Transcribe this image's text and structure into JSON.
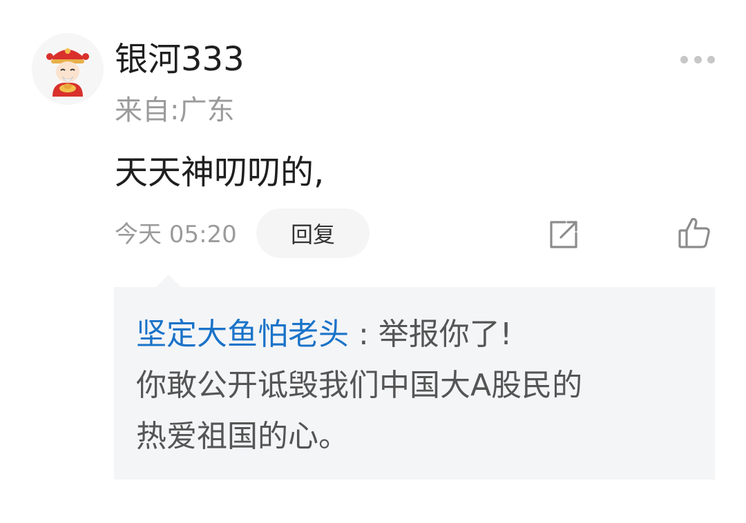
{
  "comment": {
    "username": "银河333",
    "location": "来自:广东",
    "text": "天天神叨叨的,",
    "time": "今天 05:20",
    "reply_label": "回复"
  },
  "icons": {
    "avatar": "caishen-avatar",
    "more": "more-dots-icon",
    "share": "share-icon",
    "like": "thumbs-up-icon"
  },
  "nested_reply": {
    "author": "坚定大鱼怕老头",
    "separator": " : ",
    "line1": "举报你了!",
    "line2": "你敢公开诋毁我们中国大A股民的",
    "line3": "热爱祖国的心。"
  },
  "colors": {
    "author_link": "#1a73c9",
    "secondary_text": "#9b9b9b",
    "reply_background": "#f4f5f7"
  }
}
